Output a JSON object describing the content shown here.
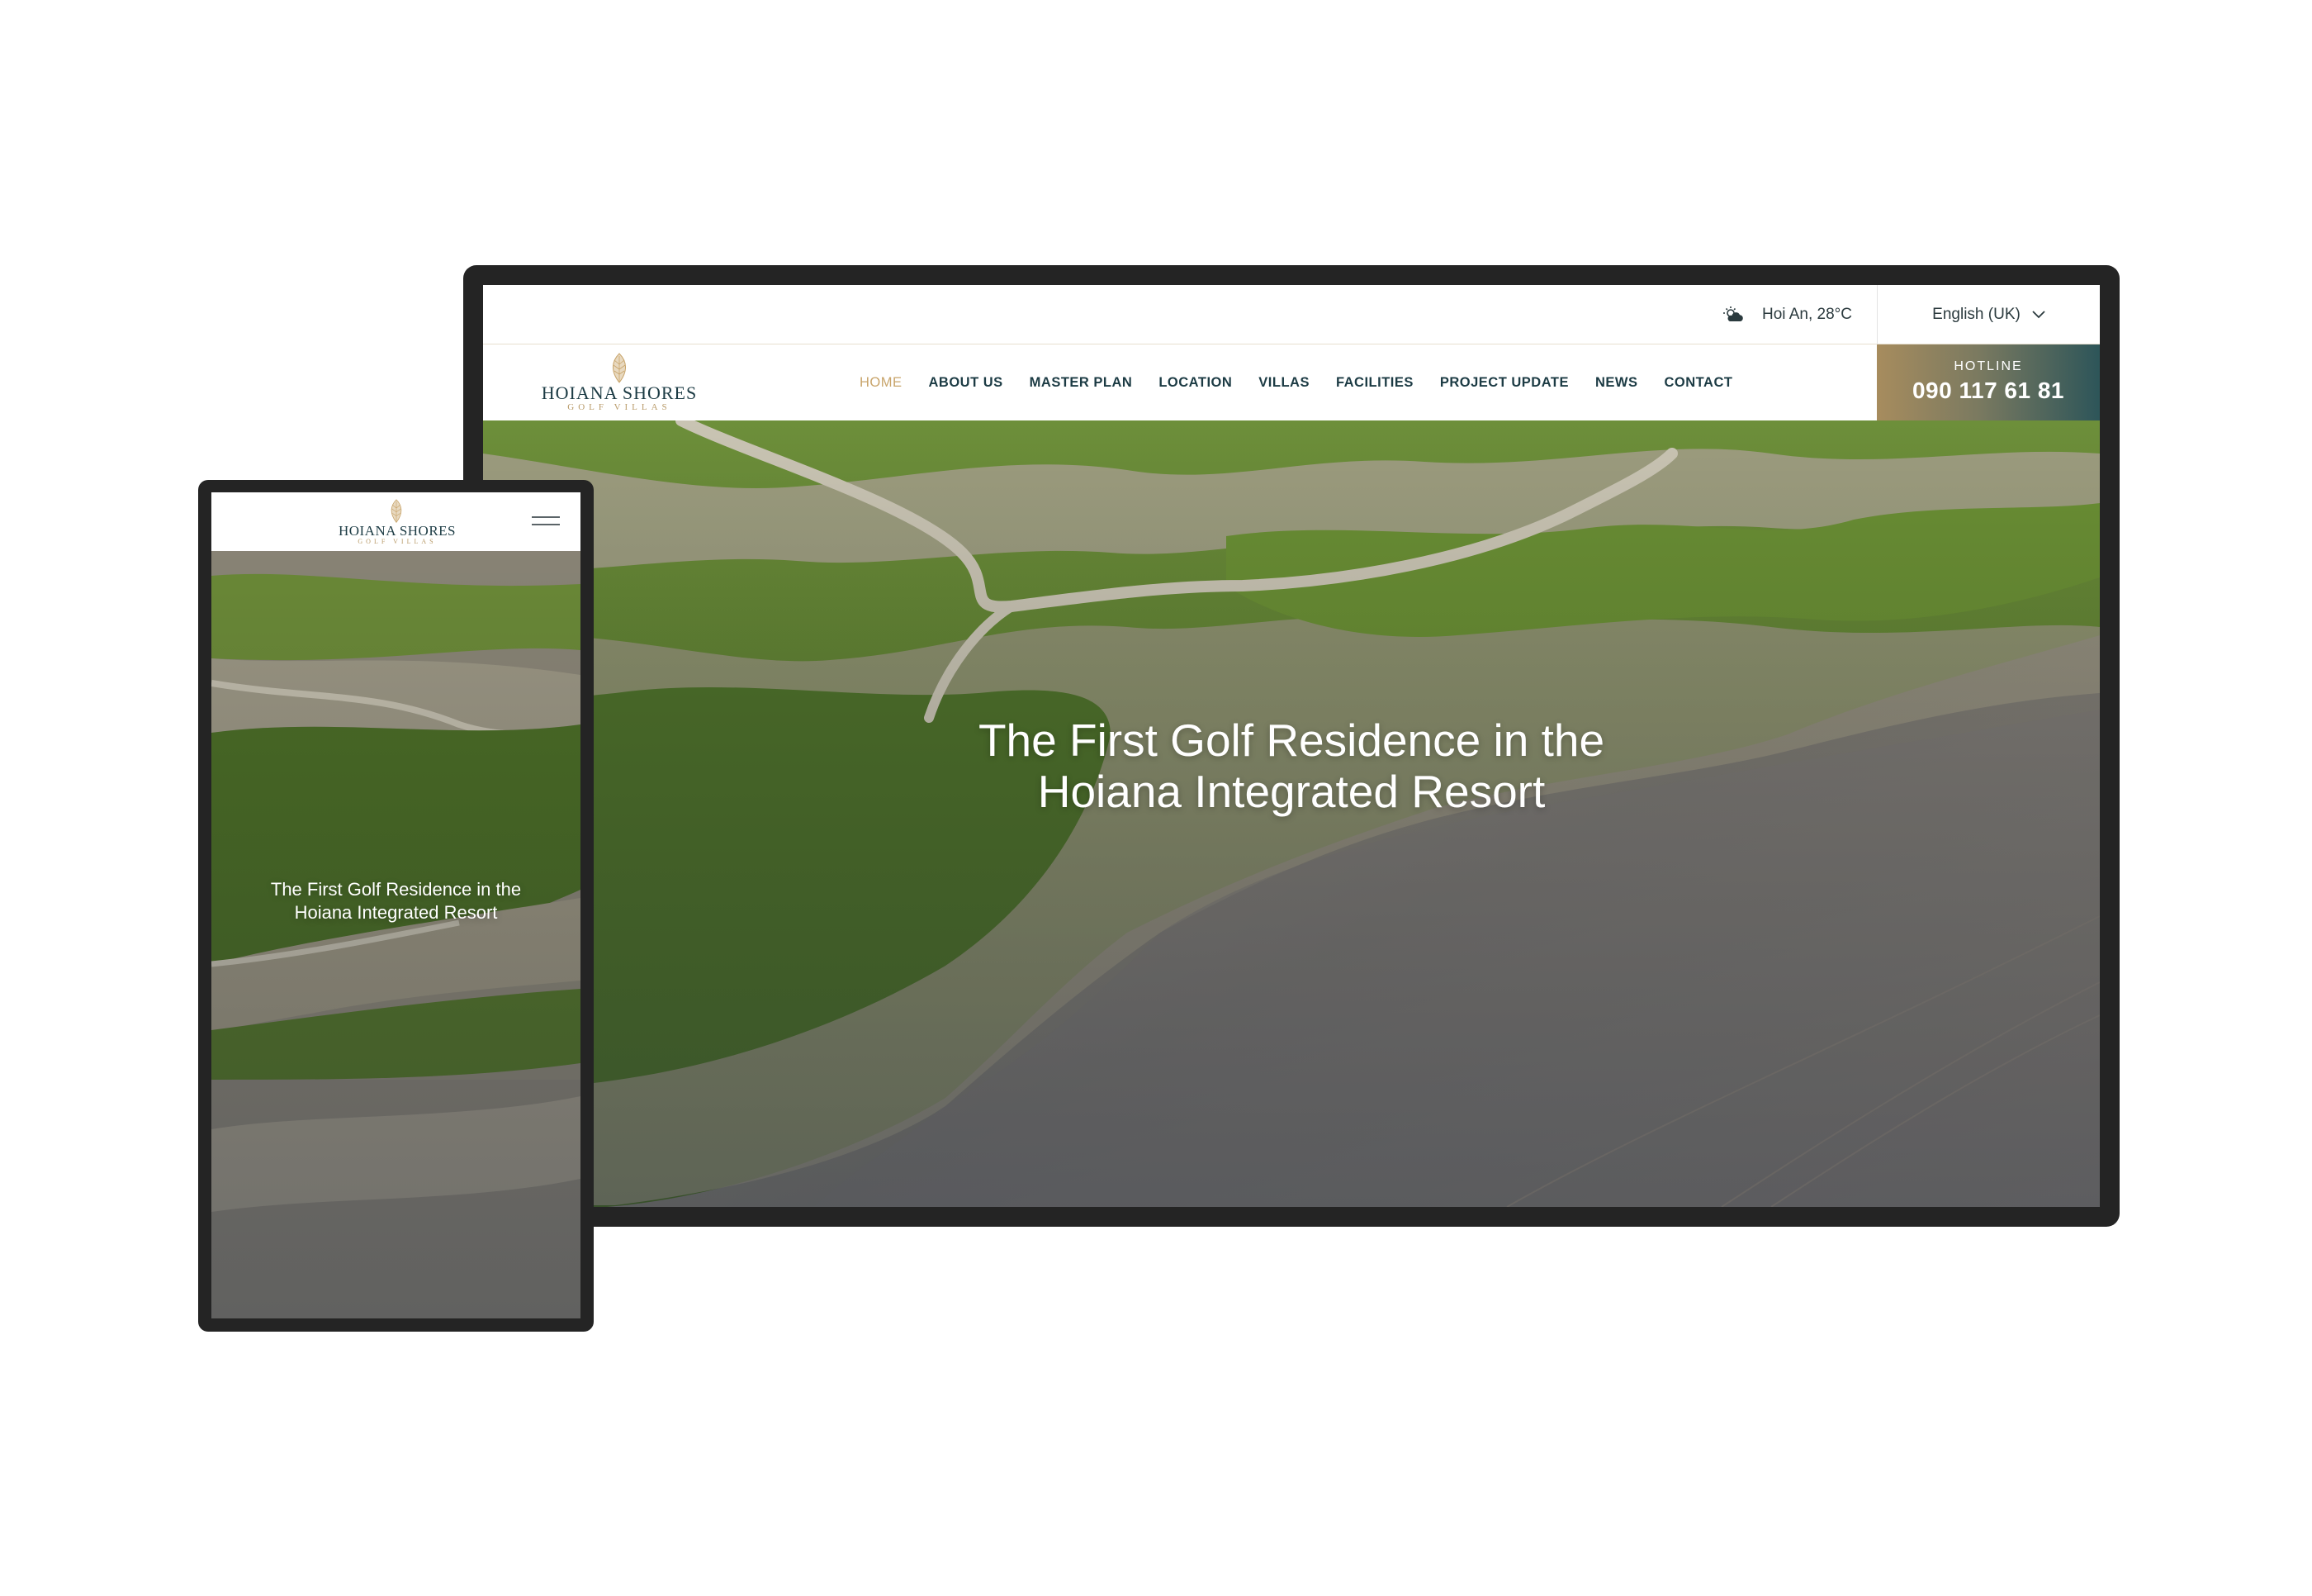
{
  "brand": {
    "name": "HOIANA SHORES",
    "tagline": "GOLF VILLAS"
  },
  "topbar": {
    "weather_icon": "cloud-sun-icon",
    "weather_text": "Hoi An, 28°C",
    "language": "English (UK)",
    "language_icon": "chevron-down-icon"
  },
  "nav": {
    "items": [
      {
        "label": "HOME",
        "active": true
      },
      {
        "label": "ABOUT US",
        "active": false
      },
      {
        "label": "MASTER PLAN",
        "active": false
      },
      {
        "label": "LOCATION",
        "active": false
      },
      {
        "label": "VILLAS",
        "active": false
      },
      {
        "label": "FACILITIES",
        "active": false
      },
      {
        "label": "PROJECT UPDATE",
        "active": false
      },
      {
        "label": "NEWS",
        "active": false
      },
      {
        "label": "CONTACT",
        "active": false
      }
    ],
    "hotline_label": "HOTLINE",
    "hotline_number": "090 117 61 81"
  },
  "hero": {
    "title_line1": "The First Golf Residence in the",
    "title_line2": "Hoiana Integrated Resort",
    "scroll_icon": "arrow-down-icon"
  },
  "mobile": {
    "menu_icon": "hamburger-menu-icon",
    "title_line1": "The First Golf Residence in the",
    "title_line2": "Hoiana Integrated Resort"
  },
  "colors": {
    "accent_gold": "#c8a46a",
    "navy": "#1c3b44",
    "device_frame": "#242424"
  }
}
